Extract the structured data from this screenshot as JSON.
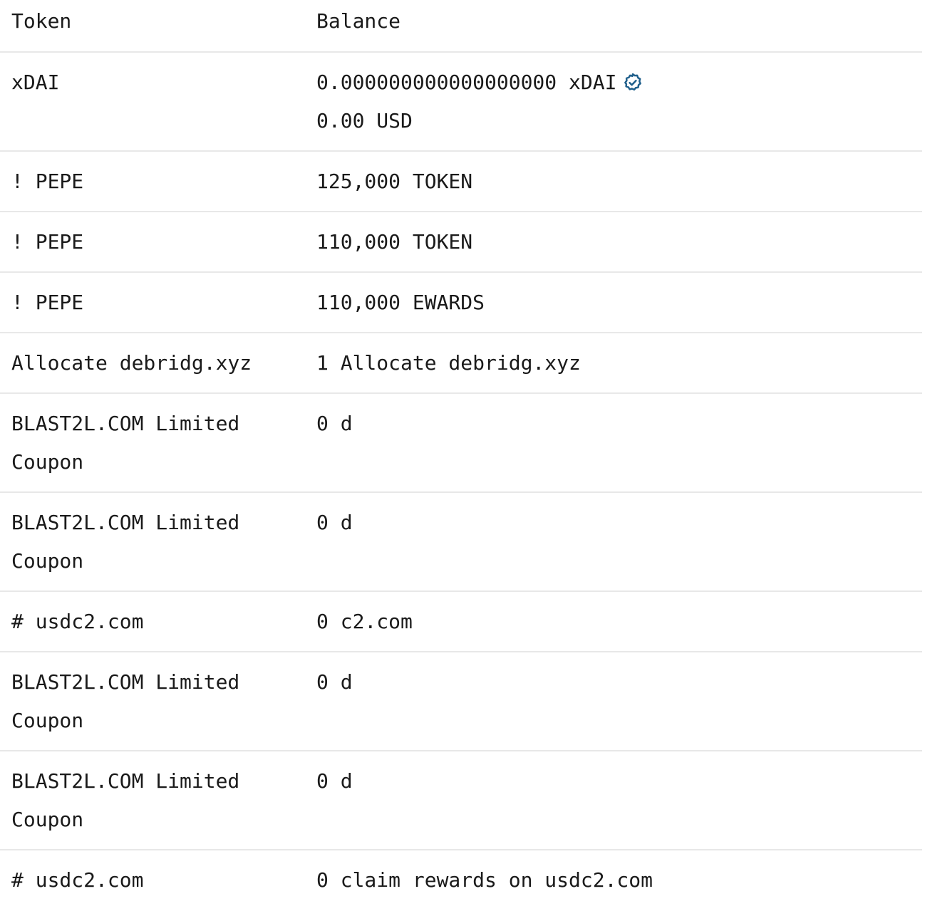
{
  "header": {
    "token": "Token",
    "balance": "Balance"
  },
  "rows": [
    {
      "token": "xDAI",
      "balance": "0.000000000000000000 xDAI",
      "usd": "0.00 USD",
      "verified": true
    },
    {
      "token": "! PEPE",
      "balance": "125,000 TOKEN"
    },
    {
      "token": "! PEPE",
      "balance": "110,000 TOKEN"
    },
    {
      "token": "! PEPE",
      "balance": "110,000 EWARDS"
    },
    {
      "token": "Allocate debridg.xyz",
      "balance": "1 Allocate debridg.xyz"
    },
    {
      "token_line1": "BLAST2L.COM Limited",
      "token_line2": "Coupon",
      "balance": "0 d"
    },
    {
      "token_line1": "BLAST2L.COM Limited",
      "token_line2": "Coupon",
      "balance": "0 d"
    },
    {
      "token": "# usdc2.com",
      "balance": "0 c2.com"
    },
    {
      "token_line1": "BLAST2L.COM Limited",
      "token_line2": "Coupon",
      "balance": "0 d"
    },
    {
      "token_line1": "BLAST2L.COM Limited",
      "token_line2": "Coupon",
      "balance": "0 d"
    },
    {
      "token": "# usdc2.com",
      "balance": "0 claim rewards on usdc2.com"
    }
  ],
  "icons": {
    "verified": "verified-badge-icon"
  },
  "colors": {
    "text": "#1a1a1a",
    "divider": "#e8e8e8",
    "verified": "#1f5f8b"
  }
}
